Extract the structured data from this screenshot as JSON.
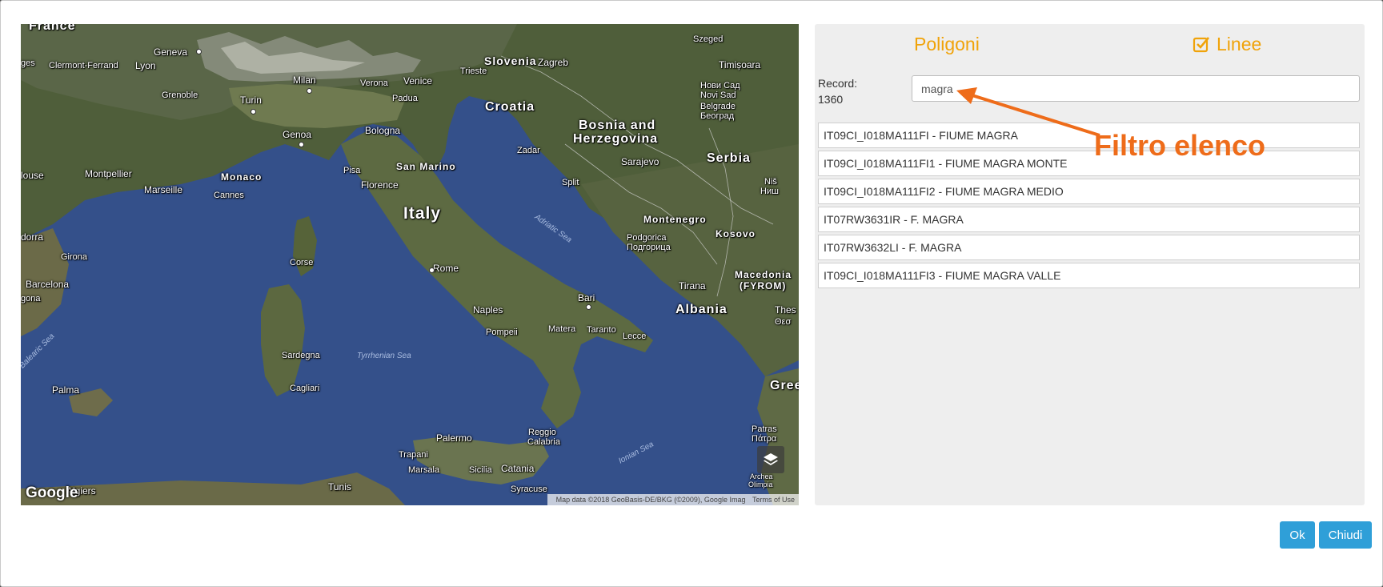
{
  "map": {
    "countries": {
      "france": "France",
      "italy": "Italy",
      "croatia": "Croatia",
      "bosnia_1": "Bosnia and",
      "bosnia_2": "Herzegovina",
      "serbia": "Serbia",
      "slovenia": "Slovenia",
      "montenegro": "Montenegro",
      "kosovo": "Kosovo",
      "albania": "Albania",
      "macedonia_1": "Macedonia",
      "macedonia_2": "(FYROM)",
      "san_marino": "San Marino",
      "monaco": "Monaco",
      "greece": "Gree"
    },
    "cities": {
      "geneva": "Geneva",
      "lyon": "Lyon",
      "clermont": "Clermont-Ferrand",
      "ges": "ges",
      "grenoble": "Grenoble",
      "turin": "Turin",
      "milan": "Milan",
      "verona": "Verona",
      "venice": "Venice",
      "padua": "Padua",
      "trieste": "Trieste",
      "zagreb": "Zagreb",
      "szeged": "Szeged",
      "timisoara": "Timișoara",
      "novi_sad_1": "Нови Сад",
      "novi_sad_2": "Novi Sad",
      "belgrade_1": "Belgrade",
      "belgrade_2": "Београд",
      "genoa": "Genoa",
      "bologna": "Bologna",
      "pisa": "Pisa",
      "florence": "Florence",
      "zadar": "Zadar",
      "sarajevo": "Sarajevo",
      "split": "Split",
      "nis_1": "Niš",
      "nis_2": "Ниш",
      "montpellier": "Montpellier",
      "marseille": "Marseille",
      "cannes": "Cannes",
      "louse": "louse",
      "dorra": "dorra",
      "girona": "Girona",
      "barcelona": "Barcelona",
      "gona": "gona",
      "corse": "Corse",
      "rome": "Rome",
      "podgorica_1": "Podgorica",
      "podgorica_2": "Подгорица",
      "tirana": "Tirana",
      "bari": "Bari",
      "naples": "Naples",
      "pompeii": "Pompeii",
      "matera": "Matera",
      "taranto": "Taranto",
      "lecce": "Lecce",
      "thes_1": "Thes",
      "thes_2": "Θεσ",
      "sardegna": "Sardegna",
      "cagliari": "Cagliari",
      "palma": "Palma",
      "palermo": "Palermo",
      "trapani": "Trapani",
      "marsala": "Marsala",
      "sicilia": "Sicilia",
      "catania": "Catania",
      "reggio_1": "Reggio",
      "reggio_2": "Calabria",
      "syracuse": "Syracuse",
      "tunis": "Tunis",
      "algiers": "Algiers",
      "patras_1": "Patras",
      "patras_2": "Πάτρα",
      "archea_1": "Archea",
      "archea_2": "Olimpia"
    },
    "seas": {
      "adriatic": "Adriatic Sea",
      "tyrrhenian": "Tyrrhenian Sea",
      "ionian": "Ionian Sea",
      "balearic": "Balearic Sea"
    },
    "logo": "Google",
    "attribution": "Map data ©2018 GeoBasis-DE/BKG (©2009), Google Imag",
    "terms": "Terms of Use",
    "layers_icon": "layers-icon"
  },
  "panel": {
    "tabs": {
      "poligoni": "Poligoni",
      "linee": "Linee"
    },
    "linee_checked": true,
    "record_label": "Record:",
    "record_count": "1360",
    "filter": {
      "value": "magra"
    },
    "items": [
      "IT09CI_I018MA111FI - FIUME MAGRA",
      "IT09CI_I018MA111FI1 - FIUME MAGRA MONTE",
      "IT09CI_I018MA111FI2 - FIUME MAGRA MEDIO",
      "IT07RW3631IR - F. MAGRA",
      "IT07RW3632LI - F. MAGRA",
      "IT09CI_I018MA111FI3 - FIUME MAGRA VALLE"
    ]
  },
  "annotation": {
    "text": "Filtro elenco",
    "color": "#ee6c1a"
  },
  "buttons": {
    "ok": "Ok",
    "chiudi": "Chiudi"
  },
  "colors": {
    "accent_tab": "#f0a30a",
    "button": "#2f9fd8",
    "panel_bg": "#eeeeee"
  }
}
